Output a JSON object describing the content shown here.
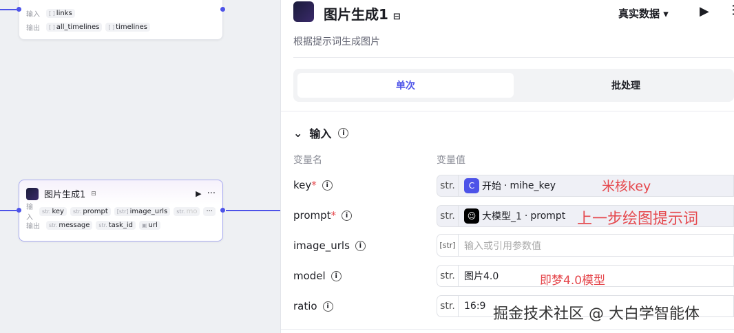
{
  "canvas": {
    "node_top": {
      "input_label": "输入",
      "inputs": [
        {
          "type": "[ ]",
          "name": "links"
        }
      ],
      "output_label": "输出",
      "outputs": [
        {
          "type": "[ ]",
          "name": "all_timelines"
        },
        {
          "type": "[ ]",
          "name": "timelines"
        }
      ]
    },
    "node_image": {
      "title": "图片生成1",
      "input_label": "输入",
      "inputs": [
        {
          "type": "str.",
          "name": "key"
        },
        {
          "type": "str.",
          "name": "prompt"
        },
        {
          "type": "[str]",
          "name": "image_urls"
        },
        {
          "type": "str.",
          "name": "mo"
        }
      ],
      "more": "···",
      "output_label": "输出",
      "outputs": [
        {
          "type": "str.",
          "name": "message"
        },
        {
          "type": "str.",
          "name": "task_id"
        },
        {
          "type": "img",
          "name": "url"
        }
      ]
    }
  },
  "panel": {
    "title": "图片生成1",
    "description": "根据提示词生成图片",
    "data_mode": "真实数据",
    "tabs": [
      {
        "label": "单次"
      },
      {
        "label": "批处理"
      }
    ],
    "section": "输入",
    "col_name": "变量名",
    "col_value": "变量值",
    "params": [
      {
        "name": "key",
        "required": "*",
        "type": "str.",
        "source": "开始",
        "value": "mihe_key",
        "note": "米核key"
      },
      {
        "name": "prompt",
        "required": "*",
        "type": "str.",
        "source": "大模型_1",
        "value": "prompt",
        "note": "上一步绘图提示词"
      },
      {
        "name": "image_urls",
        "type": "[str]",
        "placeholder": "输入或引用参数值"
      },
      {
        "name": "model",
        "type": "str.",
        "value": "图片4.0",
        "note": "即梦4.0模型"
      },
      {
        "name": "ratio",
        "type": "str.",
        "value": "16:9"
      }
    ]
  },
  "watermark": "掘金技术社区 @ 大白学智能体",
  "accent": "#4d53e8"
}
